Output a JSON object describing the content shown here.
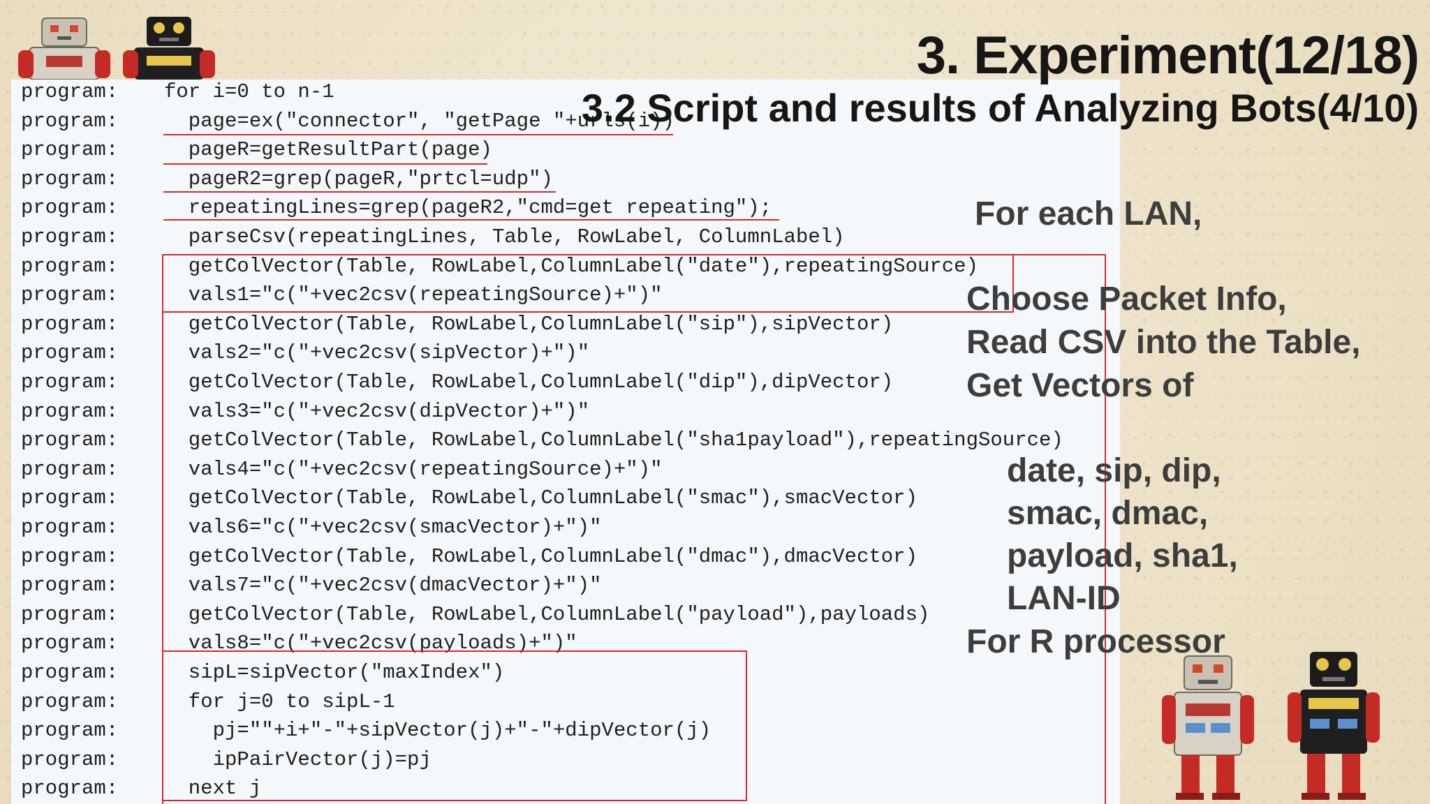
{
  "slide": {
    "title": "3. Experiment(12/18)",
    "subtitle": "3.2   Script and results of Analyzing Bots(4/10)"
  },
  "code": {
    "prefix": "program:",
    "lines": [
      "for i=0 to n-1",
      "  page=ex(\"connector\", \"getPage \"+urls(i))",
      "  pageR=getResultPart(page)",
      "  pageR2=grep(pageR,\"prtcl=udp\")",
      "  repeatingLines=grep(pageR2,\"cmd=get repeating\");",
      "  parseCsv(repeatingLines, Table, RowLabel, ColumnLabel)",
      "  getColVector(Table, RowLabel,ColumnLabel(\"date\"),repeatingSource)",
      "  vals1=\"c(\"+vec2csv(repeatingSource)+\")\"",
      "  getColVector(Table, RowLabel,ColumnLabel(\"sip\"),sipVector)",
      "  vals2=\"c(\"+vec2csv(sipVector)+\")\"",
      "  getColVector(Table, RowLabel,ColumnLabel(\"dip\"),dipVector)",
      "  vals3=\"c(\"+vec2csv(dipVector)+\")\"",
      "  getColVector(Table, RowLabel,ColumnLabel(\"sha1payload\"),repeatingSource)",
      "  vals4=\"c(\"+vec2csv(repeatingSource)+\")\"",
      "  getColVector(Table, RowLabel,ColumnLabel(\"smac\"),smacVector)",
      "  vals6=\"c(\"+vec2csv(smacVector)+\")\"",
      "  getColVector(Table, RowLabel,ColumnLabel(\"dmac\"),dmacVector)",
      "  vals7=\"c(\"+vec2csv(dmacVector)+\")\"",
      "  getColVector(Table, RowLabel,ColumnLabel(\"payload\"),payloads)",
      "  vals8=\"c(\"+vec2csv(payloads)+\")\"",
      "  sipL=sipVector(\"maxIndex\")",
      "  for j=0 to sipL-1",
      "    pj=\"\"+i+\"-\"+sipVector(j)+\"-\"+dipVector(j)",
      "    ipPairVector(j)=pj",
      "  next j"
    ]
  },
  "notes": {
    "for_each_lan": "For each LAN,",
    "choose_packet": "Choose Packet Info,",
    "read_csv": "Read CSV into the Table,",
    "get_vectors": "Get Vectors of",
    "fields": [
      "date, sip, dip,",
      "smac, dmac,",
      "payload, sha1,",
      "LAN-ID"
    ],
    "for_r": "For R processor"
  },
  "colors": {
    "annotation": "#d42a2a",
    "title": "#161616",
    "notes": "#3d3d3d",
    "code_panel": "#f5f8fb"
  },
  "icons": [
    "robot-silver-icon",
    "robot-black-icon",
    "robot-silver-icon",
    "robot-black-icon"
  ]
}
